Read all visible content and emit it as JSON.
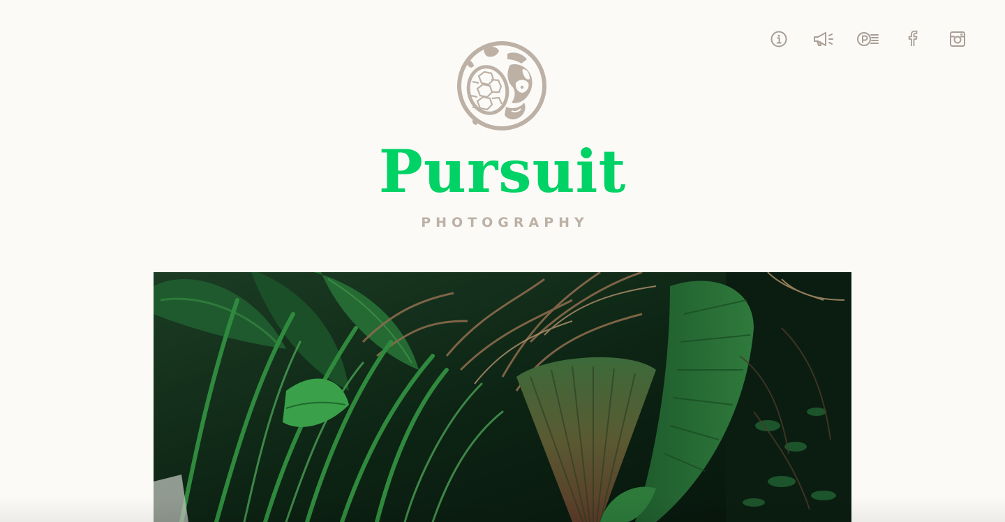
{
  "brand": {
    "name": "Pursuit",
    "subtitle": "PHOTOGRAPHY",
    "name_color": "#00d266",
    "accent_color": "#bdb1a6"
  },
  "nav": {
    "icons": [
      "info-icon",
      "megaphone-icon",
      "pinterest-icon",
      "facebook-icon",
      "instagram-icon"
    ]
  },
  "hero": {
    "subject": "tropical palm foliage photograph"
  }
}
